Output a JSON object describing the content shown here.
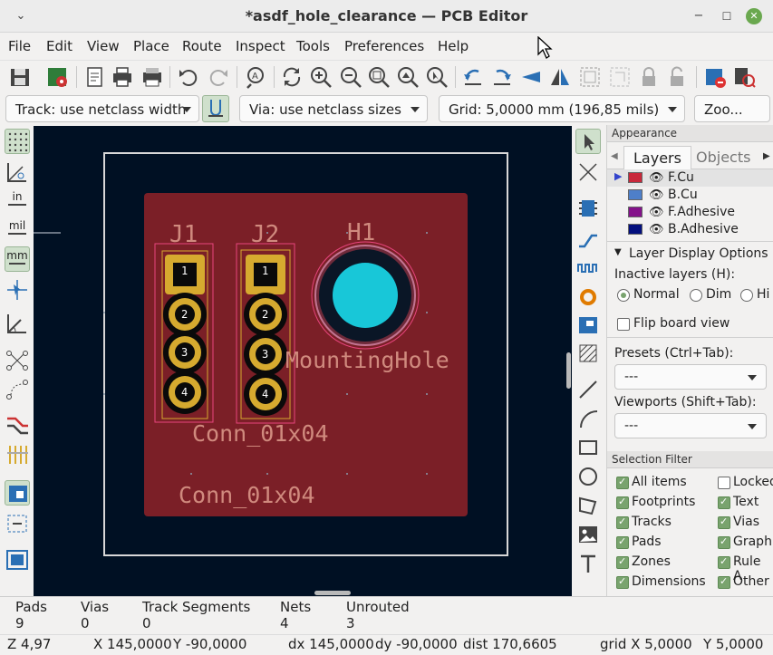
{
  "window": {
    "title": "*asdf_hole_clearance — PCB Editor"
  },
  "menu": [
    "File",
    "Edit",
    "View",
    "Place",
    "Route",
    "Inspect",
    "Tools",
    "Preferences",
    "Help"
  ],
  "toolbar2": {
    "track": "Track: use netclass width",
    "via": "Via: use netclass sizes",
    "grid": "Grid: 5,0000 mm (196,85 mils)",
    "zoom": "Zoo..."
  },
  "left_toolbar": {
    "in_label": "in",
    "mil_label": "mil",
    "mm_label": "mm"
  },
  "board": {
    "ref_j1": "J1",
    "ref_j2": "J2",
    "ref_h1": "H1",
    "value_mounting": "MountingHole",
    "value_conn_a": "Conn_01x04",
    "value_conn_b": "Conn_01x04",
    "pad_numbers": [
      "1",
      "2",
      "3",
      "4"
    ],
    "colors": {
      "board": "#7b1f27",
      "copper": "#d6aa2f",
      "hole": "#18c7d8",
      "outline": "#d8d8d8",
      "background": "#001023"
    }
  },
  "appearance": {
    "title": "Appearance",
    "tabs": [
      "Layers",
      "Objects"
    ],
    "layers": [
      {
        "name": "F.Cu",
        "color": "#c8283a"
      },
      {
        "name": "B.Cu",
        "color": "#4e7fc9"
      },
      {
        "name": "F.Adhesive",
        "color": "#84128a"
      },
      {
        "name": "B.Adhesive",
        "color": "#04107e"
      }
    ],
    "layer_display": "Layer Display Options",
    "inactive_label": "Inactive layers (H):",
    "inactive_options": [
      "Normal",
      "Dim",
      "Hi"
    ],
    "flip_label": "Flip board view",
    "presets_label": "Presets (Ctrl+Tab):",
    "presets_value": "---",
    "viewports_label": "Viewports (Shift+Tab):",
    "viewports_value": "---"
  },
  "selection_filter": {
    "title": "Selection Filter",
    "items": [
      {
        "label": "All items",
        "checked": true
      },
      {
        "label": "Locked",
        "checked": false
      },
      {
        "label": "Footprints",
        "checked": true
      },
      {
        "label": "Text",
        "checked": true
      },
      {
        "label": "Tracks",
        "checked": true
      },
      {
        "label": "Vias",
        "checked": true
      },
      {
        "label": "Pads",
        "checked": true
      },
      {
        "label": "Graphi",
        "checked": true
      },
      {
        "label": "Zones",
        "checked": true
      },
      {
        "label": "Rule A",
        "checked": true
      },
      {
        "label": "Dimensions",
        "checked": true
      },
      {
        "label": "Other",
        "checked": true
      }
    ]
  },
  "messages": [
    {
      "label": "Pads",
      "value": "9"
    },
    {
      "label": "Vias",
      "value": "0"
    },
    {
      "label": "Track Segments",
      "value": "0"
    },
    {
      "label": "Nets",
      "value": "4"
    },
    {
      "label": "Unrouted",
      "value": "3"
    }
  ],
  "status": {
    "zoom": "Z 4,97",
    "x": "X 145,0000",
    "y": "Y -90,0000",
    "dx": "dx 145,0000",
    "dy": "dy -90,0000",
    "dist": "dist 170,6605",
    "grid": "grid X 5,0000",
    "grid_y": "Y 5,0000"
  }
}
